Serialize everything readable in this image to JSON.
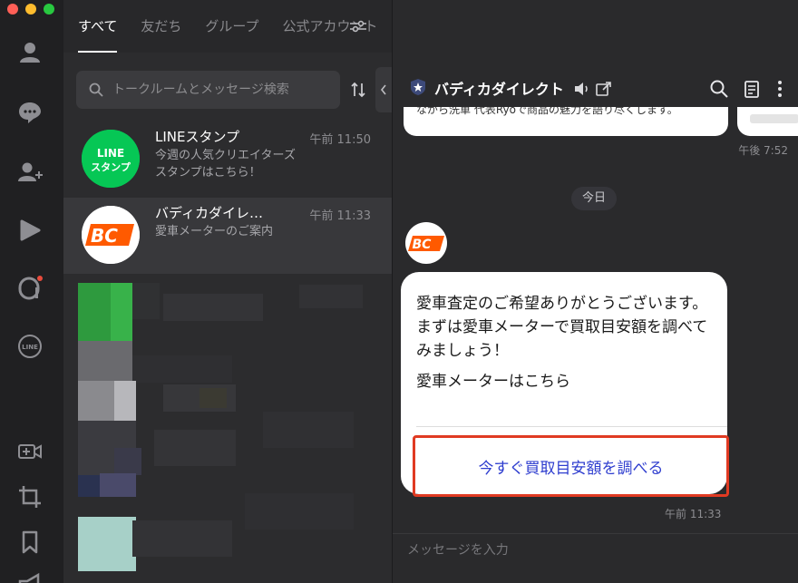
{
  "window": {
    "traffic_lights": {
      "close": "#ff5f57",
      "minimize": "#febc2e",
      "zoom": "#28c840"
    }
  },
  "rail": {
    "icons": [
      "profile-icon",
      "chat-icon",
      "add-friend-icon",
      "play-icon",
      "openchat-icon",
      "line-icon",
      "video-call-icon",
      "crop-icon",
      "bookmark-icon",
      "megaphone-icon"
    ]
  },
  "tabs": {
    "all": "すべて",
    "friends": "友だち",
    "groups": "グループ",
    "official": "公式アカウント"
  },
  "search": {
    "placeholder": "トークルームとメッセージ検索"
  },
  "chat_list": [
    {
      "name": "LINEスタンプ",
      "message": "今週の人気クリエイターズスタンプはこちら！",
      "time": "午前 11:50",
      "avatar_text_1": "LINE",
      "avatar_text_2": "スタンプ",
      "avatar_color": "#06c755"
    },
    {
      "name": "バディカダイレ…",
      "message": "愛車メーターのご案内",
      "time": "午前 11:33",
      "avatar_text": "BC",
      "avatar_color": "#ff5a00"
    }
  ],
  "chat": {
    "title": "バディカダイレクト",
    "previous_bubble_text": "ながら洗車 代表Ryoで商品の魅力を語り尽くします。",
    "previous_time": "午後 7:52",
    "date_label": "今日",
    "card": {
      "line1": "愛車査定のご希望ありがとうございます。",
      "line2": "まずは愛車メーターで買取目安額を調べてみましょう！",
      "line3": "愛車メーターはこちら",
      "button_label": "今すぐ買取目安額を調べる"
    },
    "card_time": "午前 11:33",
    "composer_placeholder": "メッセージを入力"
  },
  "colors": {
    "accent_line_green": "#06c755",
    "brand_orange": "#ff5a00",
    "highlight_red": "#e03a22",
    "link_blue": "#2f3ecf"
  }
}
